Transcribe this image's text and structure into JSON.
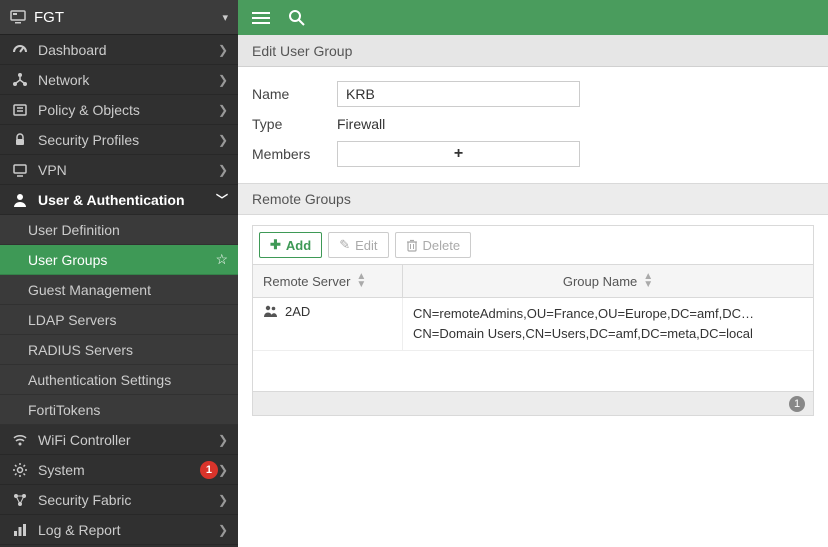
{
  "brand": "FGT",
  "sidebar": {
    "items": [
      {
        "label": "Dashboard"
      },
      {
        "label": "Network"
      },
      {
        "label": "Policy & Objects"
      },
      {
        "label": "Security Profiles"
      },
      {
        "label": "VPN"
      },
      {
        "label": "User & Authentication"
      },
      {
        "label": "WiFi Controller"
      },
      {
        "label": "System",
        "badge": "1"
      },
      {
        "label": "Security Fabric"
      },
      {
        "label": "Log & Report"
      }
    ],
    "sub": [
      {
        "label": "User Definition"
      },
      {
        "label": "User Groups"
      },
      {
        "label": "Guest Management"
      },
      {
        "label": "LDAP Servers"
      },
      {
        "label": "RADIUS Servers"
      },
      {
        "label": "Authentication Settings"
      },
      {
        "label": "FortiTokens"
      }
    ]
  },
  "page": {
    "title": "Edit User Group"
  },
  "form": {
    "name_label": "Name",
    "name_value": "KRB",
    "type_label": "Type",
    "type_value": "Firewall",
    "members_label": "Members",
    "members_placeholder": "+"
  },
  "remote": {
    "header": "Remote Groups",
    "toolbar": {
      "add": "Add",
      "edit": "Edit",
      "delete": "Delete"
    },
    "columns": {
      "server": "Remote Server",
      "group": "Group Name"
    },
    "rows": [
      {
        "server": "2AD",
        "groups": [
          "CN=remoteAdmins,OU=France,OU=Europe,DC=amf,DC…",
          "CN=Domain Users,CN=Users,DC=amf,DC=meta,DC=local"
        ]
      }
    ],
    "count": "1"
  }
}
